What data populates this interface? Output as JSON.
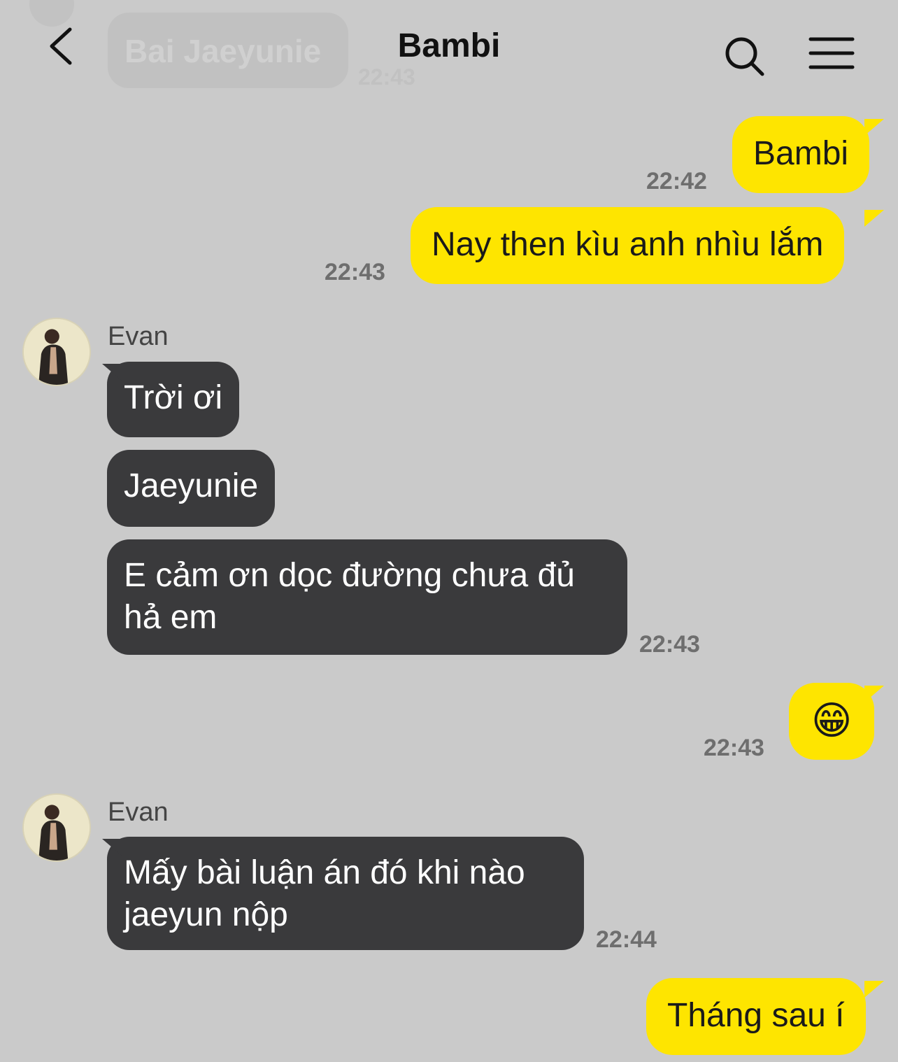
{
  "header": {
    "title": "Bambi",
    "ghost_bubble_text": "Bai Jaeyunie",
    "ghost_time": "22:43",
    "icons": {
      "back": "chevron-left-icon",
      "search": "search-icon",
      "menu": "menu-icon"
    }
  },
  "colors": {
    "background": "#cacaca",
    "my_bubble": "#fee500",
    "their_bubble": "#3a3a3c",
    "timestamp": "#6e6e6e"
  },
  "messages": [
    {
      "from": "me",
      "text": "Bambi",
      "time": "22:42"
    },
    {
      "from": "me",
      "text": "Nay then kìu anh nhìu lắm",
      "time": "22:43"
    },
    {
      "from": "them",
      "sender": "Evan",
      "text": "Trời ơi",
      "time": ""
    },
    {
      "from": "them",
      "text": "Jaeyunie",
      "time": ""
    },
    {
      "from": "them",
      "text_line1": "E cảm ơn dọc đường chưa đủ",
      "text_line2": "hả em",
      "time": "22:43"
    },
    {
      "from": "me",
      "emoji": "😁",
      "time": "22:43"
    },
    {
      "from": "them",
      "sender": "Evan",
      "text_line1": "Mấy bài luận án đó khi nào",
      "text_line2": "jaeyun nộp",
      "time": "22:44"
    },
    {
      "from": "me",
      "text": "Tháng sau í",
      "time": ""
    }
  ]
}
